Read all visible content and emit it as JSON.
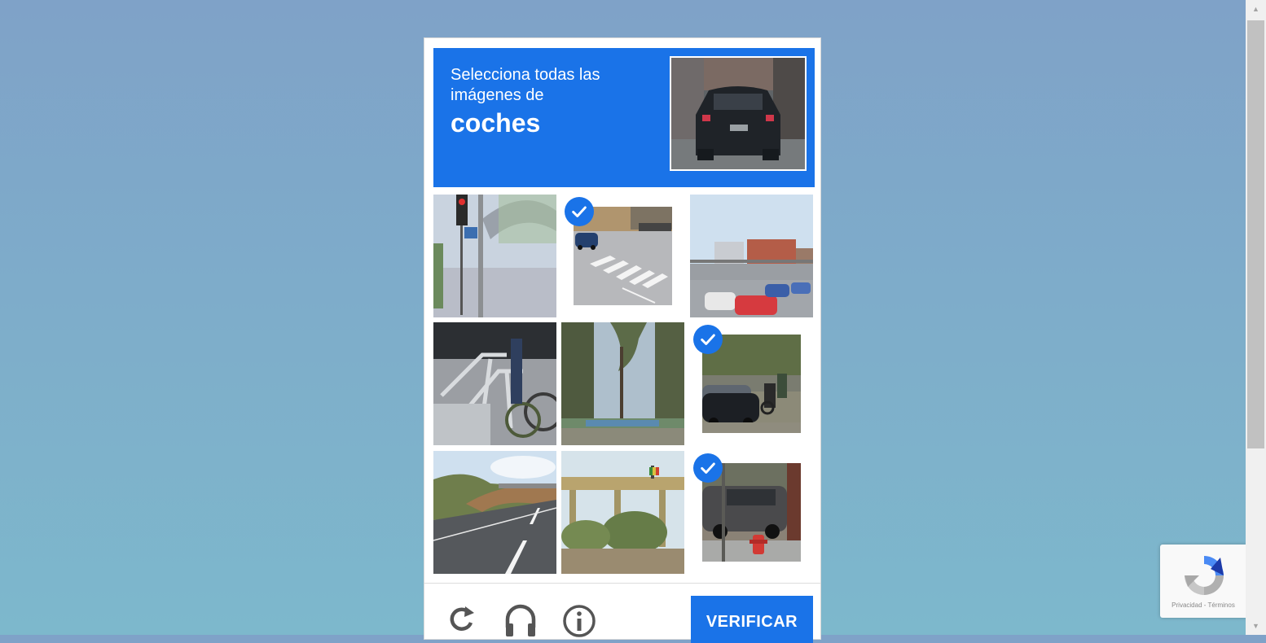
{
  "challenge": {
    "instruction_line1": "Selecciona todas las",
    "instruction_line2": "imágenes de",
    "target": "coches",
    "colors": {
      "accent": "#1a73e8",
      "white": "#ffffff"
    }
  },
  "grid": {
    "tiles": [
      {
        "selected": false,
        "content": "traffic light and overpass"
      },
      {
        "selected": true,
        "content": "crosswalk with car"
      },
      {
        "selected": false,
        "content": "highway traffic with buildings"
      },
      {
        "selected": false,
        "content": "bicycles at rack"
      },
      {
        "selected": false,
        "content": "trees"
      },
      {
        "selected": true,
        "content": "car and motorcycle on street"
      },
      {
        "selected": false,
        "content": "empty road"
      },
      {
        "selected": false,
        "content": "gantry structure with flag"
      },
      {
        "selected": true,
        "content": "parked car and fire hydrant"
      }
    ]
  },
  "toolbar": {
    "reload_icon": "reload-icon",
    "audio_icon": "headphones-icon",
    "info_icon": "info-icon",
    "verify_label": "VERIFICAR"
  },
  "badge": {
    "links": "Privacidad - Términos"
  }
}
